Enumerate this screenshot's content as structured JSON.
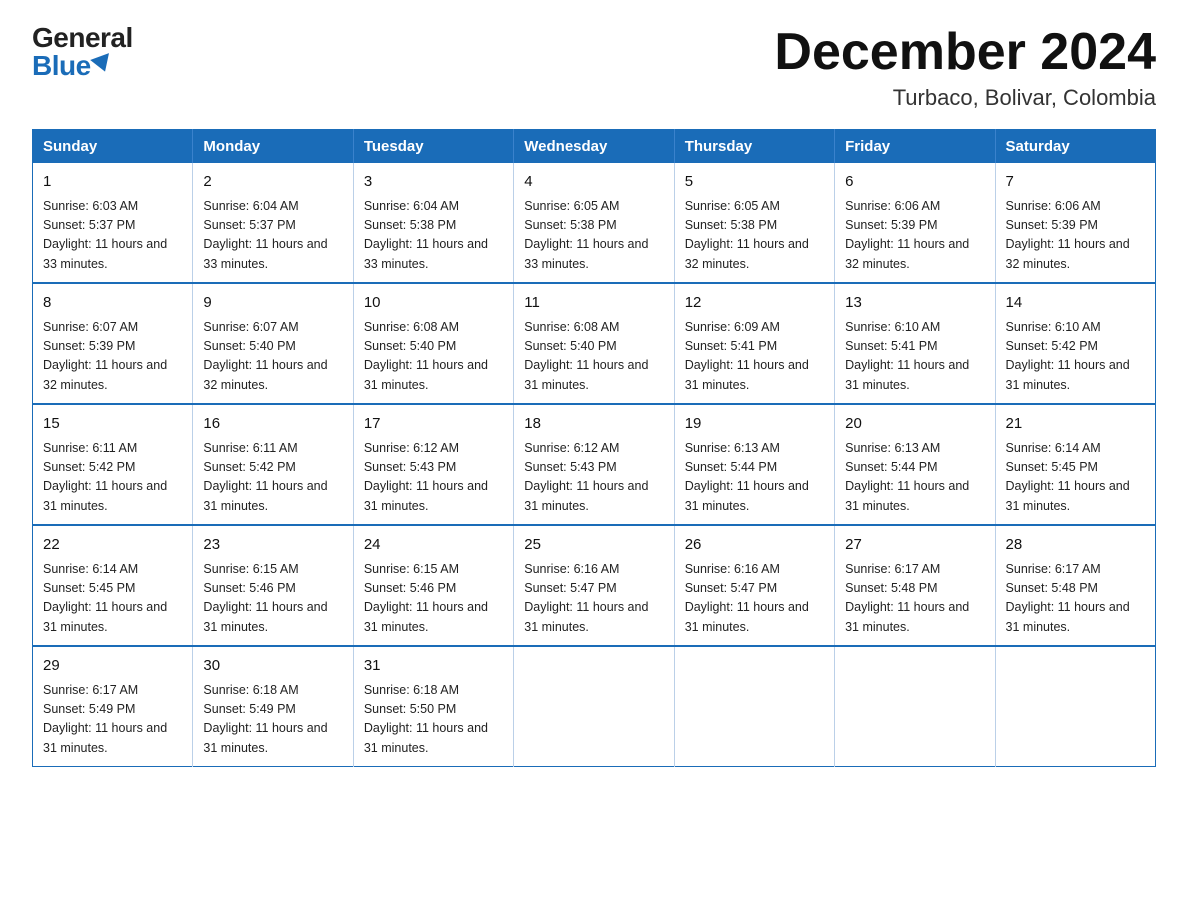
{
  "logo": {
    "general": "General",
    "blue": "Blue"
  },
  "title": "December 2024",
  "subtitle": "Turbaco, Bolivar, Colombia",
  "weekdays": [
    "Sunday",
    "Monday",
    "Tuesday",
    "Wednesday",
    "Thursday",
    "Friday",
    "Saturday"
  ],
  "weeks": [
    [
      {
        "day": "1",
        "sunrise": "6:03 AM",
        "sunset": "5:37 PM",
        "daylight": "11 hours and 33 minutes."
      },
      {
        "day": "2",
        "sunrise": "6:04 AM",
        "sunset": "5:37 PM",
        "daylight": "11 hours and 33 minutes."
      },
      {
        "day": "3",
        "sunrise": "6:04 AM",
        "sunset": "5:38 PM",
        "daylight": "11 hours and 33 minutes."
      },
      {
        "day": "4",
        "sunrise": "6:05 AM",
        "sunset": "5:38 PM",
        "daylight": "11 hours and 33 minutes."
      },
      {
        "day": "5",
        "sunrise": "6:05 AM",
        "sunset": "5:38 PM",
        "daylight": "11 hours and 32 minutes."
      },
      {
        "day": "6",
        "sunrise": "6:06 AM",
        "sunset": "5:39 PM",
        "daylight": "11 hours and 32 minutes."
      },
      {
        "day": "7",
        "sunrise": "6:06 AM",
        "sunset": "5:39 PM",
        "daylight": "11 hours and 32 minutes."
      }
    ],
    [
      {
        "day": "8",
        "sunrise": "6:07 AM",
        "sunset": "5:39 PM",
        "daylight": "11 hours and 32 minutes."
      },
      {
        "day": "9",
        "sunrise": "6:07 AM",
        "sunset": "5:40 PM",
        "daylight": "11 hours and 32 minutes."
      },
      {
        "day": "10",
        "sunrise": "6:08 AM",
        "sunset": "5:40 PM",
        "daylight": "11 hours and 31 minutes."
      },
      {
        "day": "11",
        "sunrise": "6:08 AM",
        "sunset": "5:40 PM",
        "daylight": "11 hours and 31 minutes."
      },
      {
        "day": "12",
        "sunrise": "6:09 AM",
        "sunset": "5:41 PM",
        "daylight": "11 hours and 31 minutes."
      },
      {
        "day": "13",
        "sunrise": "6:10 AM",
        "sunset": "5:41 PM",
        "daylight": "11 hours and 31 minutes."
      },
      {
        "day": "14",
        "sunrise": "6:10 AM",
        "sunset": "5:42 PM",
        "daylight": "11 hours and 31 minutes."
      }
    ],
    [
      {
        "day": "15",
        "sunrise": "6:11 AM",
        "sunset": "5:42 PM",
        "daylight": "11 hours and 31 minutes."
      },
      {
        "day": "16",
        "sunrise": "6:11 AM",
        "sunset": "5:42 PM",
        "daylight": "11 hours and 31 minutes."
      },
      {
        "day": "17",
        "sunrise": "6:12 AM",
        "sunset": "5:43 PM",
        "daylight": "11 hours and 31 minutes."
      },
      {
        "day": "18",
        "sunrise": "6:12 AM",
        "sunset": "5:43 PM",
        "daylight": "11 hours and 31 minutes."
      },
      {
        "day": "19",
        "sunrise": "6:13 AM",
        "sunset": "5:44 PM",
        "daylight": "11 hours and 31 minutes."
      },
      {
        "day": "20",
        "sunrise": "6:13 AM",
        "sunset": "5:44 PM",
        "daylight": "11 hours and 31 minutes."
      },
      {
        "day": "21",
        "sunrise": "6:14 AM",
        "sunset": "5:45 PM",
        "daylight": "11 hours and 31 minutes."
      }
    ],
    [
      {
        "day": "22",
        "sunrise": "6:14 AM",
        "sunset": "5:45 PM",
        "daylight": "11 hours and 31 minutes."
      },
      {
        "day": "23",
        "sunrise": "6:15 AM",
        "sunset": "5:46 PM",
        "daylight": "11 hours and 31 minutes."
      },
      {
        "day": "24",
        "sunrise": "6:15 AM",
        "sunset": "5:46 PM",
        "daylight": "11 hours and 31 minutes."
      },
      {
        "day": "25",
        "sunrise": "6:16 AM",
        "sunset": "5:47 PM",
        "daylight": "11 hours and 31 minutes."
      },
      {
        "day": "26",
        "sunrise": "6:16 AM",
        "sunset": "5:47 PM",
        "daylight": "11 hours and 31 minutes."
      },
      {
        "day": "27",
        "sunrise": "6:17 AM",
        "sunset": "5:48 PM",
        "daylight": "11 hours and 31 minutes."
      },
      {
        "day": "28",
        "sunrise": "6:17 AM",
        "sunset": "5:48 PM",
        "daylight": "11 hours and 31 minutes."
      }
    ],
    [
      {
        "day": "29",
        "sunrise": "6:17 AM",
        "sunset": "5:49 PM",
        "daylight": "11 hours and 31 minutes."
      },
      {
        "day": "30",
        "sunrise": "6:18 AM",
        "sunset": "5:49 PM",
        "daylight": "11 hours and 31 minutes."
      },
      {
        "day": "31",
        "sunrise": "6:18 AM",
        "sunset": "5:50 PM",
        "daylight": "11 hours and 31 minutes."
      },
      null,
      null,
      null,
      null
    ]
  ],
  "labels": {
    "sunrise_prefix": "Sunrise: ",
    "sunset_prefix": "Sunset: ",
    "daylight_prefix": "Daylight: "
  }
}
